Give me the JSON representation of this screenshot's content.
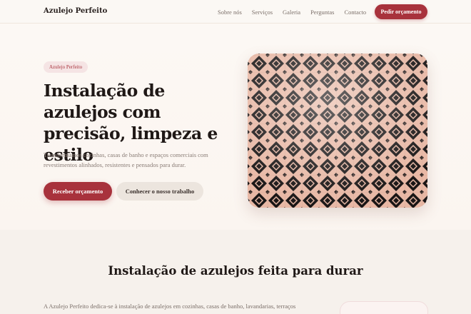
{
  "nav": {
    "brand": "Azulejo Perfeito",
    "links": [
      "Sobre nós",
      "Serviços",
      "Galeria",
      "Perguntas",
      "Contacto"
    ],
    "cta": "Pedir orçamento"
  },
  "hero": {
    "badge": "Azulejo Perfeito",
    "title": "Instalação de azulejos com precisão, limpeza e estilo",
    "subtitle": "Transformamos cozinhas, casas de banho e espaços comerciais com revestimentos alinhados, resistentes e pensados para durar.",
    "primary_button": "Receber orçamento",
    "secondary_button": "Conhecer o nosso trabalho"
  },
  "section2": {
    "title": "Instalação de azulejos feita para durar",
    "body": "A Azulejo Perfeito dedica-se à instalação de azulejos em cozinhas, casas de banho, lavandarias, terraços"
  },
  "colors": {
    "accent": "#a8323c",
    "background": "#faf6f1",
    "tile_base": "#e6b6a3",
    "tile_ink": "#1a1616"
  }
}
